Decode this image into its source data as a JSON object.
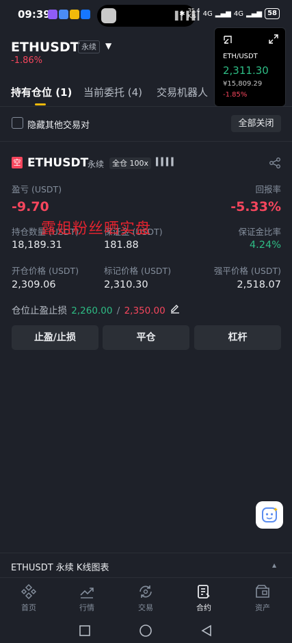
{
  "status_bar": {
    "time": "09:39",
    "net_speed": "35.4 K/s",
    "signal1": "4G",
    "signal2": "4G",
    "battery": "58"
  },
  "header": {
    "pair": "ETHUSDT",
    "perp_tag": "永续",
    "change": "-1.86%"
  },
  "mini_window": {
    "symbol": "ETH/USDT",
    "price": "2,311.30",
    "cny": "¥15,809.29",
    "change": "-1.85%"
  },
  "tabs": [
    {
      "label": "持有仓位 (1)",
      "active": true
    },
    {
      "label": "当前委托 (4)",
      "active": false
    },
    {
      "label": "交易机器人",
      "active": false
    }
  ],
  "filter": {
    "hide_label": "隐藏其他交易对",
    "close_all": "全部关闭"
  },
  "position": {
    "side_badge": "空",
    "symbol": "ETHUSDT",
    "type": "永续",
    "margin_leverage": "全仓 100x",
    "pnl_label": "盈亏 (USDT)",
    "pnl_value": "-9.70",
    "roe_label": "回报率",
    "roe_value": "-5.33%",
    "size_label": "持仓数量 (USDT)",
    "size_value": "18,189.31",
    "margin_label": "保证金 (USDT)",
    "margin_value": "181.88",
    "margin_ratio_label": "保证金比率",
    "margin_ratio_value": "4.24%",
    "entry_label": "开仓价格 (USDT)",
    "entry_value": "2,309.06",
    "mark_label": "标记价格 (USDT)",
    "mark_value": "2,310.30",
    "liq_label": "强平价格 (USDT)",
    "liq_value": "2,518.07",
    "tpsl_label": "仓位止盈止损",
    "tp_value": "2,260.00",
    "sep": "/",
    "sl_value": "2,350.00"
  },
  "watermark": "露姐粉丝晒实盘",
  "actions": {
    "tpsl": "止盈/止损",
    "close": "平仓",
    "leverage": "杠杆"
  },
  "kline_bar": {
    "label": "ETHUSDT 永续 K线图表"
  },
  "bottom_nav": [
    {
      "label": "首页",
      "icon": "home-icon"
    },
    {
      "label": "行情",
      "icon": "markets-icon"
    },
    {
      "label": "交易",
      "icon": "trade-icon"
    },
    {
      "label": "合约",
      "icon": "futures-icon",
      "active": true
    },
    {
      "label": "资产",
      "icon": "wallet-icon"
    }
  ],
  "colors": {
    "background": "#1e2129",
    "accent": "#f0b90b",
    "up": "#2ebd85",
    "down": "#f6465d"
  }
}
